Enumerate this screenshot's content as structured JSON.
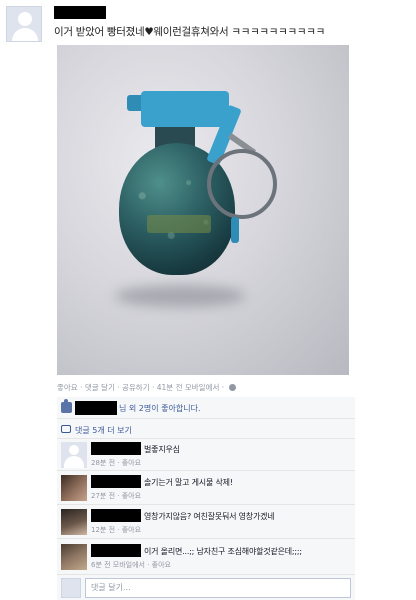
{
  "post": {
    "text": "이거 받았어 빵터졌네♥웨이런걸휴쳐와서 ㅋㅋㅋㅋㅋㅋㅋㅋㅋㅋ",
    "actions": {
      "like": "좋아요",
      "comment": "댓글 달기",
      "share": "공유하기",
      "time": "41분 전 모바일에서"
    }
  },
  "feedback": {
    "likes_text": "님 외 2명이 좋아합니다.",
    "more_comments": "댓글 5개 더 보기",
    "comments": [
      {
        "text": "벌좋지우심",
        "time": "28분 전",
        "like": "좋아요",
        "avatar": "default"
      },
      {
        "text": "솔기는거 말고 게시물 삭제!",
        "time": "27분 전",
        "like": "좋아요",
        "avatar": "photo1"
      },
      {
        "text": "영창가지않음? 여친잘못둬서 영창가겠네",
        "time": "12분 전",
        "like": "좋아요",
        "avatar": "photo2"
      },
      {
        "text": "이거 올리면...;; 남자친구 조심해야할것같은데;;;;",
        "time": "6분 전 모바일에서",
        "like": "좋아요",
        "avatar": "photo3"
      }
    ],
    "write_placeholder": "댓글 달기..."
  },
  "icons": [
    "default-avatar-icon",
    "thumbs-up-icon",
    "comment-bubble-icon",
    "globe-icon"
  ],
  "colors": {
    "link": "#3b5998",
    "meta": "#9197a3",
    "feedback_bg": "#f6f7f9"
  }
}
